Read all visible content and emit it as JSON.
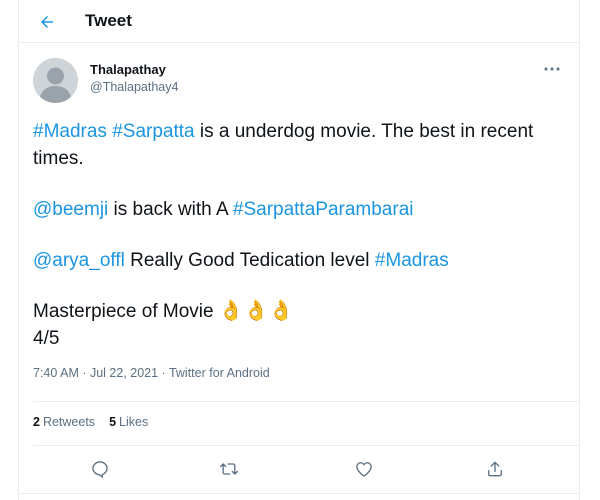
{
  "header": {
    "title": "Tweet"
  },
  "author": {
    "name": "Thalapathay",
    "handle": "@Thalapathay4"
  },
  "tweet": {
    "line1": [
      {
        "text": "#Madras",
        "link": true
      },
      {
        "text": " ",
        "link": false
      },
      {
        "text": "#Sarpatta",
        "link": true
      },
      {
        "text": " is a underdog movie. The best in recent times.",
        "link": false
      }
    ],
    "line2": [
      {
        "text": "@beemji",
        "link": true
      },
      {
        "text": " is back with A ",
        "link": false
      },
      {
        "text": "#SarpattaParambarai",
        "link": true
      }
    ],
    "line3": [
      {
        "text": "@arya_offl",
        "link": true
      },
      {
        "text": "  Really Good Tedication level ",
        "link": false
      },
      {
        "text": "#Madras",
        "link": true
      }
    ],
    "line4_text": "Masterpiece of Movie",
    "emojis": [
      "👌",
      "👌",
      "👌"
    ],
    "rating": "4/5"
  },
  "meta": {
    "time": "7:40 AM · Jul 22, 2021 · Twitter for Android"
  },
  "stats": {
    "retweets_count": "2",
    "retweets_label": "Retweets",
    "likes_count": "5",
    "likes_label": "Likes"
  },
  "actions": [
    "reply-icon",
    "retweet-icon",
    "like-icon",
    "share-icon"
  ],
  "colors": {
    "link": "#1b95e0",
    "secondary_text": "#5b7083",
    "border": "#ebeef0"
  }
}
